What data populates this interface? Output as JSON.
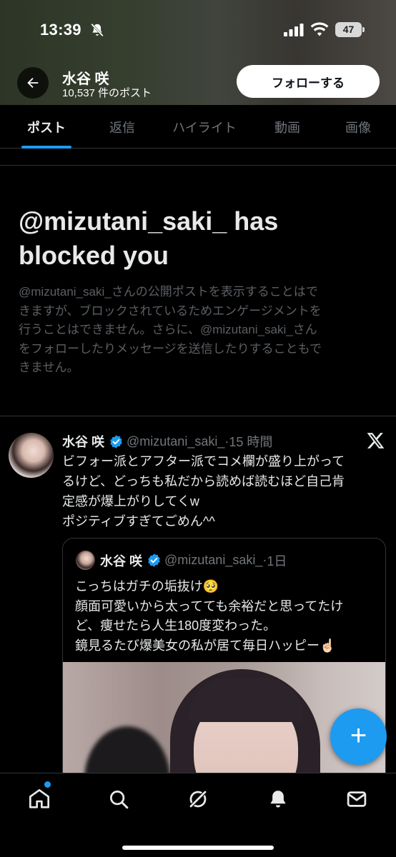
{
  "status_bar": {
    "time": "13:39",
    "battery": "47"
  },
  "profile": {
    "name": "水谷 咲",
    "post_count": "10,537 件のポスト",
    "follow_label": "フォローする"
  },
  "tabs": [
    {
      "label": "ポスト",
      "active": true
    },
    {
      "label": "返信",
      "active": false
    },
    {
      "label": "ハイライト",
      "active": false
    },
    {
      "label": "動画",
      "active": false
    },
    {
      "label": "画像",
      "active": false
    }
  ],
  "blocked": {
    "title_line1": "@mizutani_saki_ has",
    "title_line2": "blocked you",
    "description_lines": [
      "@mizutani_saki_さんの公開ポストを表示することはで",
      "きますが、ブロックされているためエンゲージメントを",
      "行うことはできません。さらに、@mizutani_saki_さん",
      "をフォローしたりメッセージを送信したりすることもで",
      "きません。"
    ]
  },
  "post": {
    "name": "水谷 咲",
    "handle": "@mizutani_saki_",
    "dot": "·",
    "time": "15 時間",
    "text_lines": [
      "ビフォー派とアフター派でコメ欄が盛り上がって",
      "るけど、どっちも私だから読めば読むほど自己肯",
      "定感が爆上がりしてくw",
      "ポジティブすぎてごめん^^"
    ]
  },
  "quote": {
    "name": "水谷 咲",
    "handle": "@mizutani_saki_",
    "dot": "·",
    "time": "1日",
    "text_lines": [
      "こっちはガチの垢抜け🥺",
      "顔面可愛いから太ってても余裕だと思ってたけ",
      "ど、痩せたら人生180度変わった。",
      "鏡見るたび爆美女の私が居て毎日ハッピー☝🏻"
    ]
  },
  "colors": {
    "accent": "#1d9bf0",
    "background": "#000000",
    "muted_text": "#71767b"
  },
  "icons": {
    "back": "arrow-left-icon",
    "fab": "plus-icon",
    "nav": [
      "home-icon",
      "search-icon",
      "grok-icon",
      "notifications-icon",
      "messages-icon"
    ]
  }
}
